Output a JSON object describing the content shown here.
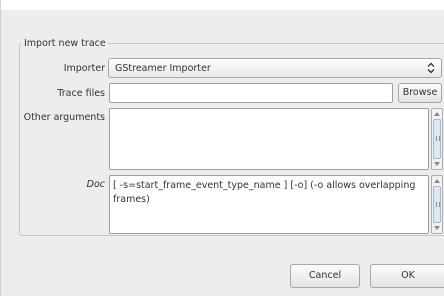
{
  "dialog": {
    "group_title": "Import new trace",
    "importer": {
      "label": "Importer",
      "selected": "GStreamer Importer"
    },
    "trace_files": {
      "label": "Trace files",
      "value": "",
      "browse_label": "Browse"
    },
    "other_arguments": {
      "label": "Other arguments",
      "value": ""
    },
    "doc": {
      "label": "Doc",
      "text": "[ -s=start_frame_event_type_name ] [-o] (-o allows overlapping frames)"
    },
    "buttons": {
      "cancel_label": "Cancel",
      "ok_label": "OK"
    }
  },
  "icons": {
    "importer_dropdown": "chevron-updown-icon",
    "scroll_up": "arrow-up-icon",
    "scroll_down": "arrow-down-icon"
  },
  "colors": {
    "window_bg": "#ededed",
    "field_bg": "#ffffff",
    "scroll_thumb": "#dfe7f1"
  }
}
